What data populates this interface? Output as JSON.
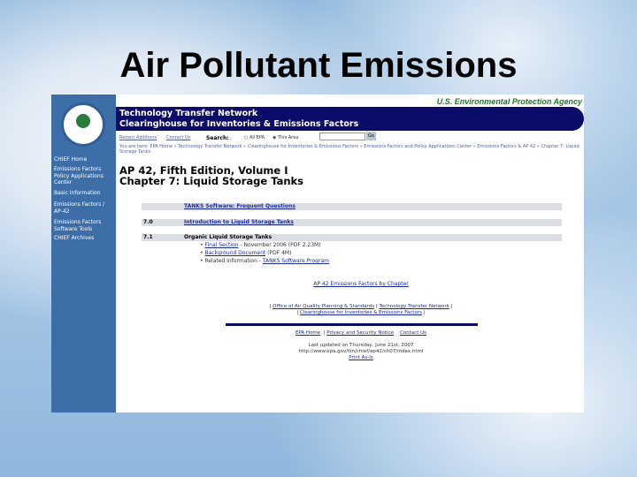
{
  "slide": {
    "title": "Air Pollutant Emissions"
  },
  "page": {
    "agency": "U.S. Environmental Protection Agency",
    "header": {
      "line1": "Technology Transfer Network",
      "line2": "Clearinghouse for Inventories & Emissions Factors"
    },
    "toplinks": {
      "recent": "Recent Additions",
      "contact": "Contact Us",
      "search_label": "Search:",
      "opt_all": "All EPA",
      "opt_area": "This Area",
      "go": "Go"
    },
    "breadcrumb": "You are here: EPA Home » Technology Transfer Network » Clearinghouse for Inventories & Emissions Factors » Emissions Factors and Policy Applications Center » Emissions Factors & AP 42 » Chapter 7: Liquid Storage Tanks",
    "sidebar": [
      "CHIEF Home",
      "Emissions Factors Policy Applications Center",
      "Basic Information",
      "Emissions Factors / AP-42",
      "Emissions Factors Software Tools",
      "CHIEF Archives"
    ],
    "title1": "AP 42, Fifth Edition, Volume I",
    "title2": "Chapter 7: Liquid Storage Tanks",
    "rows": [
      {
        "num": "",
        "label": "TANKS Software: Frequent Questions"
      },
      {
        "num": "7.0",
        "label": "Introduction to Liquid Storage Tanks"
      },
      {
        "num": "7.1",
        "label": "Organic Liquid Storage Tanks"
      }
    ],
    "bullets": [
      {
        "link": "Final Section",
        "text": " - November 2006 (PDF 2.23M)"
      },
      {
        "link": "Background Document",
        "text": " (PDF 4M)"
      },
      {
        "pre": "Related Information - ",
        "link": "TANKS Software Program"
      }
    ],
    "by_chapter": "AP 42 Emissions Factors by Chapter",
    "footer_links": [
      "Office of Air Quality Planning & Standards",
      "Technology Transfer Network",
      "Clearinghouse for Inventories & Emissions Factors"
    ],
    "bottom_links": [
      "EPA Home",
      "Privacy and Security Notice",
      "Contact Us"
    ],
    "updated": "Last updated on Thursday, June 21st, 2007",
    "url": "http://www.epa.gov/ttn/chief/ap42/ch07/index.html",
    "print": "Print As-Is"
  }
}
